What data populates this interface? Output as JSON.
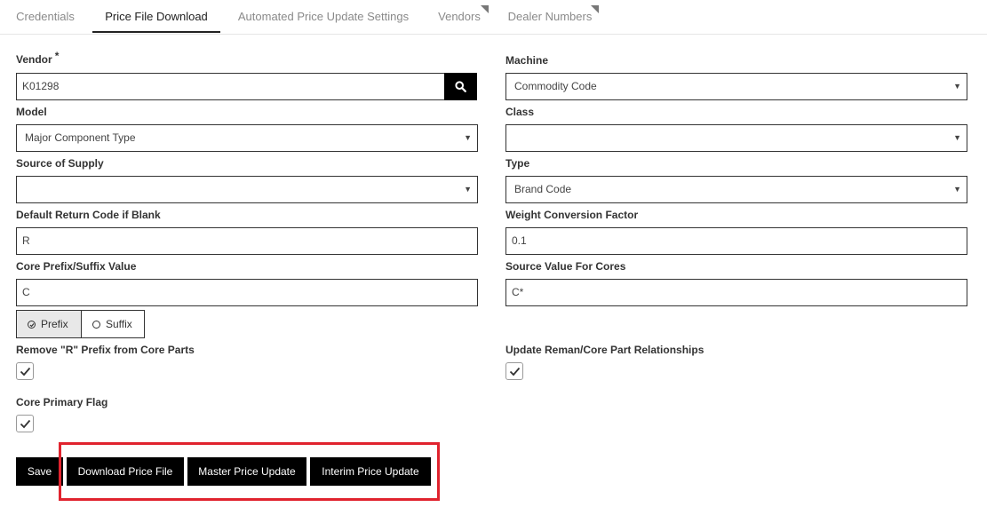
{
  "tabs": [
    {
      "label": "Credentials",
      "active": false
    },
    {
      "label": "Price File Download",
      "active": true
    },
    {
      "label": "Automated Price Update Settings",
      "active": false
    },
    {
      "label": "Vendors",
      "active": false
    },
    {
      "label": "Dealer Numbers",
      "active": false
    }
  ],
  "form": {
    "vendor": {
      "label": "Vendor",
      "required": "*",
      "value": "K01298"
    },
    "machine": {
      "label": "Machine",
      "value": "Commodity Code"
    },
    "model": {
      "label": "Model",
      "value": "Major Component Type"
    },
    "class": {
      "label": "Class",
      "value": ""
    },
    "source_of_supply": {
      "label": "Source of Supply",
      "value": ""
    },
    "type": {
      "label": "Type",
      "value": "Brand Code"
    },
    "default_return_code": {
      "label": "Default Return Code if Blank",
      "value": "R"
    },
    "weight_conversion": {
      "label": "Weight Conversion Factor",
      "value": "0.1"
    },
    "core_prefix_suffix": {
      "label": "Core Prefix/Suffix Value",
      "value": "C"
    },
    "source_value_cores": {
      "label": "Source Value For Cores",
      "value": "C*"
    },
    "prefix_suffix": {
      "prefix_label": "Prefix",
      "suffix_label": "Suffix",
      "selected": "prefix"
    },
    "remove_r_prefix": {
      "label": "Remove \"R\" Prefix from Core Parts",
      "checked": true
    },
    "update_reman": {
      "label": "Update Reman/Core Part Relationships",
      "checked": true
    },
    "core_primary_flag": {
      "label": "Core Primary Flag",
      "checked": true
    }
  },
  "actions": {
    "save": "Save",
    "download": "Download Price File",
    "master": "Master Price Update",
    "interim": "Interim Price Update"
  },
  "colors": {
    "highlight": "#e0232e",
    "button_bg": "#000000"
  }
}
